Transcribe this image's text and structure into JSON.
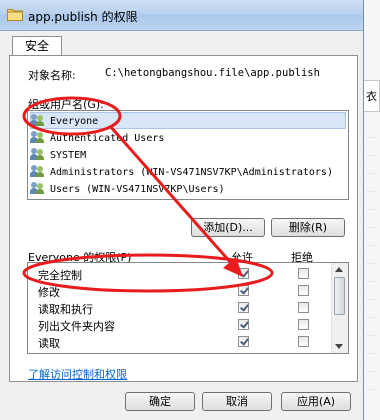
{
  "window": {
    "title": "app.publish 的权限"
  },
  "tabs": [
    {
      "label": "安全"
    }
  ],
  "object": {
    "label": "对象名称:",
    "value": "C:\\hetongbangshou.file\\app.publish"
  },
  "groups": {
    "label": "组或用户名(G):",
    "items": [
      {
        "name": "Everyone",
        "icon": "user-group-icon",
        "selected": true
      },
      {
        "name": "Authenticated Users",
        "icon": "user-group-icon"
      },
      {
        "name": "SYSTEM",
        "icon": "user-group-icon"
      },
      {
        "name": "Administrators (WIN-VS471NSV7KP\\Administrators)",
        "icon": "user-group-icon"
      },
      {
        "name": "Users (WIN-VS471NSV7KP\\Users)",
        "icon": "user-group-icon"
      }
    ]
  },
  "buttons": {
    "add": "添加(D)...",
    "remove": "删除(R)",
    "ok": "确定",
    "cancel": "取消",
    "apply": "应用(A)"
  },
  "permissions": {
    "title": "Everyone 的权限(P)",
    "allow_header": "允许",
    "deny_header": "拒绝",
    "rows": [
      {
        "name": "完全控制",
        "allow": true,
        "deny": false
      },
      {
        "name": "修改",
        "allow": true,
        "deny": false
      },
      {
        "name": "读取和执行",
        "allow": true,
        "deny": false
      },
      {
        "name": "列出文件夹内容",
        "allow": true,
        "deny": false
      },
      {
        "name": "读取",
        "allow": true,
        "deny": false
      }
    ]
  },
  "link": "了解访问控制和权限",
  "background": {
    "partial_text": "衣"
  },
  "colors": {
    "annotation": "#e81c1c",
    "link": "#0066cc",
    "selection": "#d8e6f7"
  }
}
